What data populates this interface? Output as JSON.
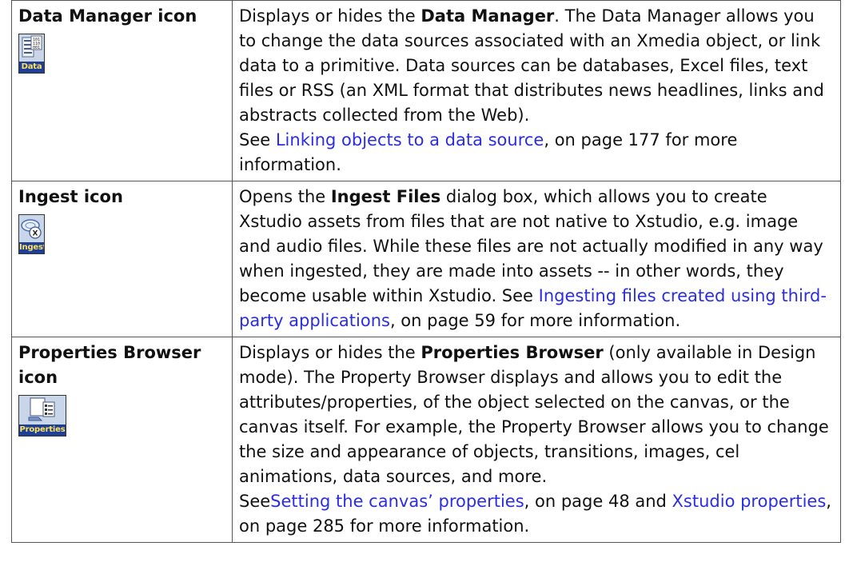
{
  "rows": [
    {
      "term": "Data Manager icon",
      "icon": {
        "name": "data-manager-icon",
        "caption": "Data"
      },
      "paragraphs": [
        {
          "p1": "Displays or hides the ",
          "b1": "Data Manager",
          "p2": ". The Data Manager allows you to change the data sources associated with an Xmedia object, or link data to a primitive. Data sources can be databases, Excel files, text files or RSS (an XML format that distributes news headlines, links and abstracts collected from the Web)."
        },
        {
          "p1": "See ",
          "link1": "Linking objects to a data source",
          "p2": ", on page 177 for more information."
        }
      ]
    },
    {
      "term": "Ingest icon",
      "icon": {
        "name": "ingest-icon",
        "caption": "Ingest"
      },
      "paragraphs": [
        {
          "p1": "Opens the ",
          "b1": "Ingest Files",
          "p2": " dialog box, which allows you to create Xstudio assets from files that are not native to Xstudio, e.g. image and audio files. While these files are not actually modified in any way when ingested, they are made into assets -- in other words, they become usable within Xstudio. See ",
          "link1": "Ingesting files created using third-party applications",
          "p3": ", on page 59 for more information."
        }
      ]
    },
    {
      "term": "Properties Browser icon",
      "icon": {
        "name": "properties-browser-icon",
        "caption": "Properties"
      },
      "paragraphs": [
        {
          "p1": "Displays or hides the ",
          "b1": "Properties Browser",
          "p2": " (only available in Design mode). The Property Browser displays and allows you to edit the attributes/properties, of the object selected on the canvas, or the canvas itself. For example, the Property Browser allows you to change the size and appearance of objects, transitions, images, cel animations, data sources, and more."
        },
        {
          "p1": "See",
          "link1": "Setting the canvas’ properties",
          "p2": ", on page 48 and ",
          "link2": "Xstudio properties",
          "p3": ", on page 285 for more information."
        }
      ]
    }
  ],
  "colors": {
    "link": "#2b2ee0",
    "icon_caption_bg": "#1d3f96",
    "icon_caption_text": "#ffe15a"
  }
}
